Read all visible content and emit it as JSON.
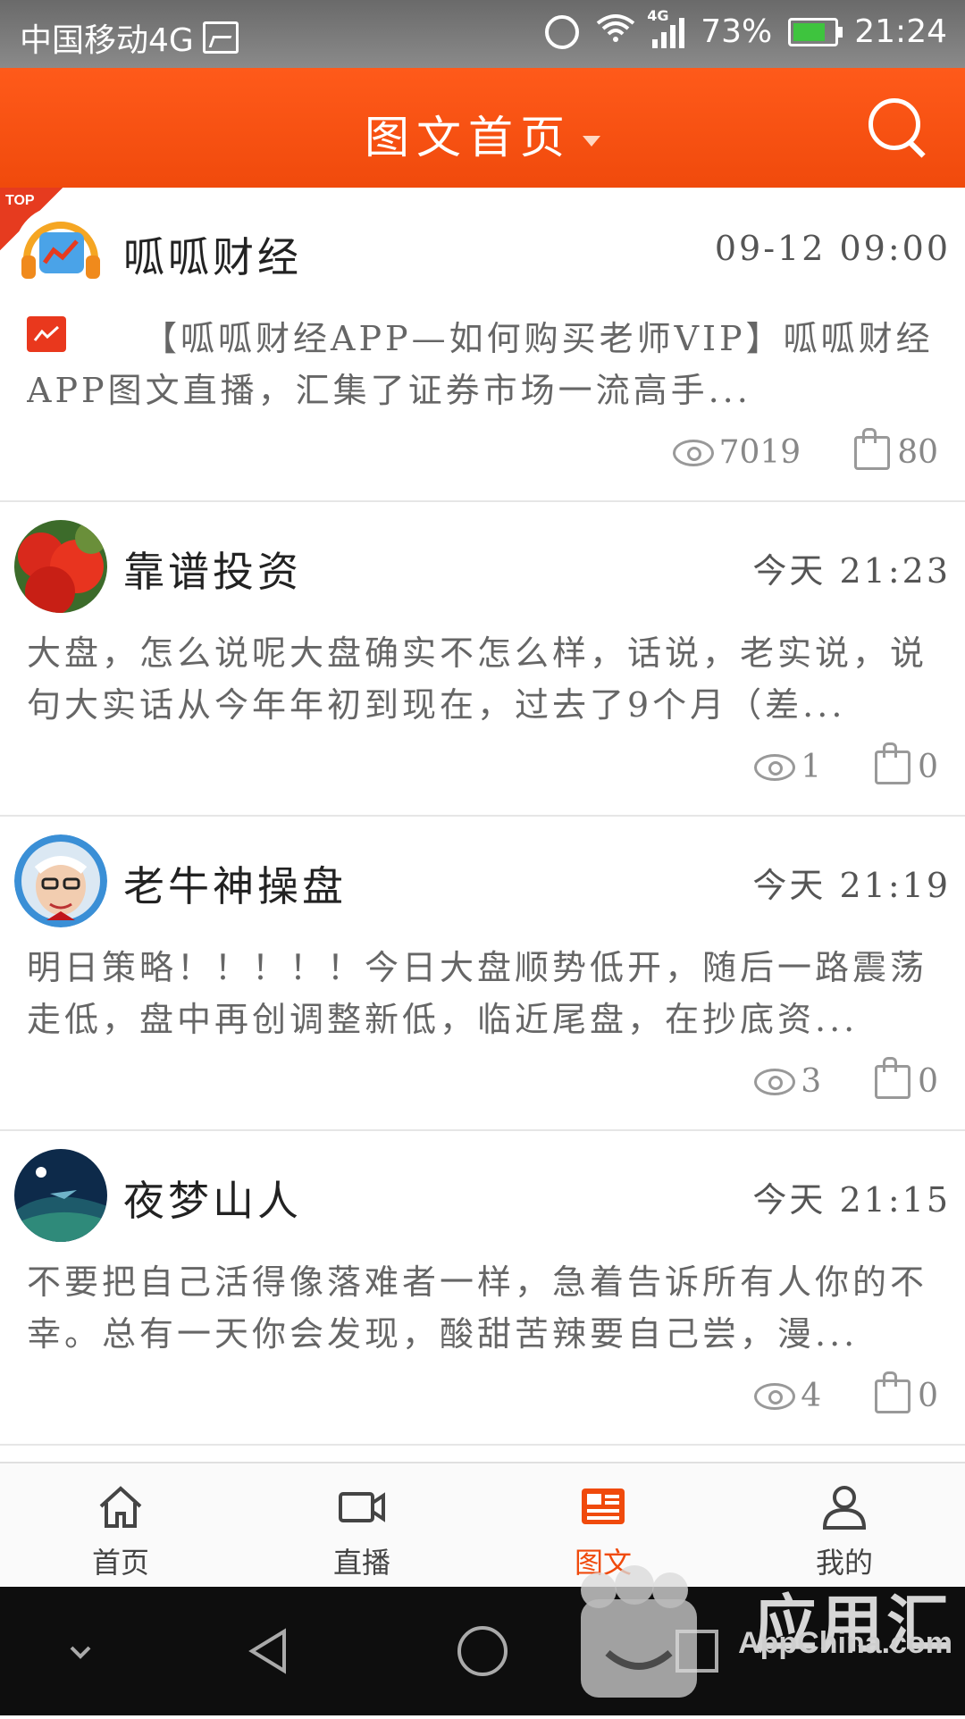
{
  "status_bar": {
    "carrier": "中国移动4G",
    "network_badge": "4G",
    "battery": "73%",
    "time": "21:24"
  },
  "app_bar": {
    "title": "图文首页"
  },
  "posts": [
    {
      "author": "呱呱财经",
      "time": "09-12  09:00",
      "excerpt": "【呱呱财经APP—如何购买老师VIP】呱呱财经APP图文直播，汇集了证券市场一流高手...",
      "views": "7019",
      "likes": "80",
      "pinned_label": "TOP"
    },
    {
      "author": "靠谱投资",
      "time": "今天  21:23",
      "excerpt": "大盘，怎么说呢大盘确实不怎么样，话说，老实说，说句大实话从今年年初到现在，过去了9个月（差...",
      "views": "1",
      "likes": "0"
    },
    {
      "author": "老牛神操盘",
      "time": "今天  21:19",
      "excerpt": "明日策略！！！！！今日大盘顺势低开，随后一路震荡走低，盘中再创调整新低，临近尾盘，在抄底资...",
      "views": "3",
      "likes": "0"
    },
    {
      "author": "夜梦山人",
      "time": "今天  21:15",
      "excerpt": "不要把自己活得像落难者一样，急着告诉所有人你的不幸。总有一天你会发现，酸甜苦辣要自己尝，漫...",
      "views": "4",
      "likes": "0"
    }
  ],
  "bottom_nav": {
    "items": [
      {
        "label": "首页",
        "icon": "home-icon"
      },
      {
        "label": "直播",
        "icon": "video-icon"
      },
      {
        "label": "图文",
        "icon": "article-icon",
        "active": true
      },
      {
        "label": "我的",
        "icon": "profile-icon"
      }
    ]
  },
  "watermark": {
    "brand": "应用汇",
    "domain": "AppChina.com"
  },
  "colors": {
    "accent": "#f04a0c",
    "top_badge": "#e63b1f"
  }
}
